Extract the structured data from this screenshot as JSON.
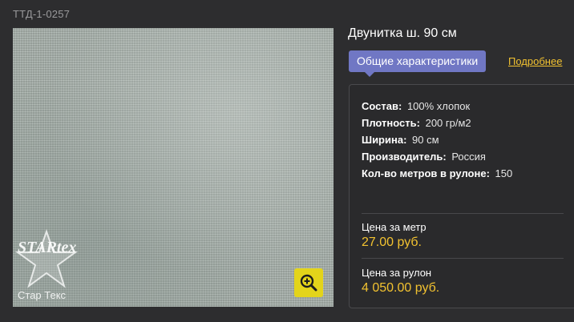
{
  "product": {
    "sku": "ТТД-1-0257",
    "title": "Двунитка ш. 90 см"
  },
  "image": {
    "logo_text": "Стар Текс",
    "logo_mark_text": "STARtex",
    "zoom_icon": "zoom-in-icon"
  },
  "tabs": {
    "general_label": "Общие характеристики",
    "more_label": "Подробнее"
  },
  "specs": [
    {
      "label": "Состав:",
      "value": "100% хлопок"
    },
    {
      "label": "Плотность:",
      "value": "200 гр/м2"
    },
    {
      "label": "Ширина:",
      "value": "90 см"
    },
    {
      "label": "Производитель:",
      "value": "Россия"
    },
    {
      "label": "Кол-во метров в рулоне:",
      "value": "150"
    }
  ],
  "prices": {
    "per_meter_label": "Цена за метр",
    "per_meter_value": "27.00 руб.",
    "per_roll_label": "Цена за рулон",
    "per_roll_value": "4 050.00 руб."
  },
  "colors": {
    "background": "#2d2d2f",
    "accent_tab": "#7077c4",
    "accent_price": "#f2c230",
    "zoom_button": "#e3d41a"
  }
}
